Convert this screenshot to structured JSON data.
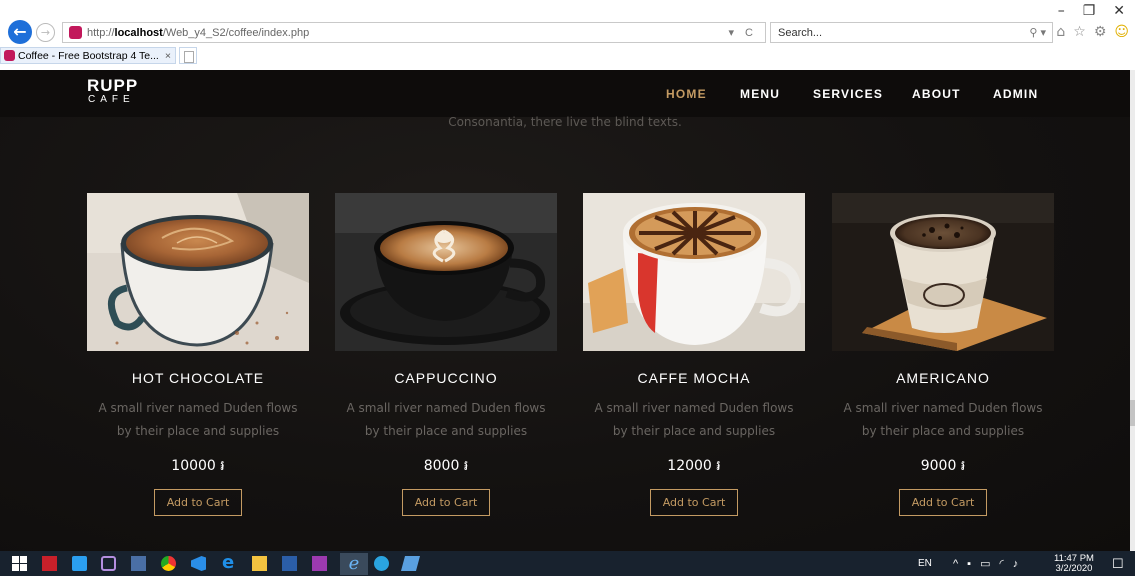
{
  "browser": {
    "url_protocol": "http://",
    "url_host": "localhost",
    "url_path": "/Web_y4_S2/coffee/index.php",
    "address_tools": "▾ C",
    "search_placeholder": "Search...",
    "tab_title": "Coffee - Free Bootstrap 4 Te...",
    "tab_close": "×"
  },
  "site": {
    "brand_main": "RUPP",
    "brand_sub": "CAFE",
    "nav": [
      {
        "label": "HOME",
        "active": true
      },
      {
        "label": "MENU",
        "active": false
      },
      {
        "label": "SERVICES",
        "active": false
      },
      {
        "label": "ABOUT",
        "active": false
      },
      {
        "label": "ADMIN",
        "active": false
      }
    ],
    "tagline": "Consonantia, there live the blind texts."
  },
  "products": [
    {
      "name": "HOT CHOCOLATE",
      "desc_line1": "A small river named Duden flows",
      "desc_line2": "by their place and supplies",
      "price": "10000 ៛",
      "button": "Add to Cart"
    },
    {
      "name": "CAPPUCCINO",
      "desc_line1": "A small river named Duden flows",
      "desc_line2": "by their place and supplies",
      "price": "8000 ៛",
      "button": "Add to Cart"
    },
    {
      "name": "CAFFE MOCHA",
      "desc_line1": "A small river named Duden flows",
      "desc_line2": "by their place and supplies",
      "price": "12000 ៛",
      "button": "Add to Cart"
    },
    {
      "name": "AMERICANO",
      "desc_line1": "A small river named Duden flows",
      "desc_line2": "by their place and supplies",
      "price": "9000 ៛",
      "button": "Add to Cart"
    }
  ],
  "taskbar": {
    "lang": "EN",
    "time": "11:47 PM",
    "date": "3/2/2020"
  },
  "colors": {
    "accent": "#c49b63",
    "page_bg": "#141211",
    "taskbar": "#18222e",
    "browser_blue": "#1e6fd9"
  }
}
